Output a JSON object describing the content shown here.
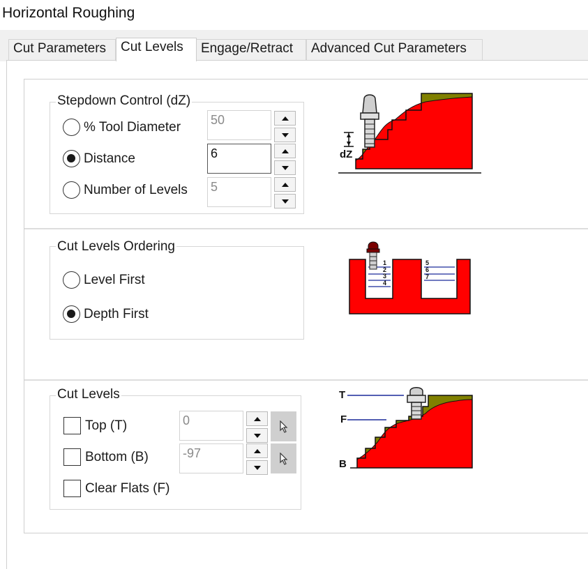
{
  "window": {
    "title": "Horizontal Roughing"
  },
  "tabs": [
    {
      "label": "Cut Parameters",
      "active": false
    },
    {
      "label": "Cut Levels",
      "active": true
    },
    {
      "label": "Engage/Retract",
      "active": false
    },
    {
      "label": "Advanced Cut Parameters",
      "active": false
    }
  ],
  "stepdown": {
    "title": "Stepdown Control (dZ)",
    "options": [
      {
        "label": "% Tool Diameter",
        "selected": false,
        "value": "50"
      },
      {
        "label": "Distance",
        "selected": true,
        "value": "6"
      },
      {
        "label": "Number of Levels",
        "selected": false,
        "value": "5"
      }
    ],
    "illustration": {
      "dz_label": "dZ"
    }
  },
  "ordering": {
    "title": "Cut Levels Ordering",
    "options": [
      {
        "label": "Level First",
        "selected": false
      },
      {
        "label": "Depth First",
        "selected": true
      }
    ],
    "illustration": {
      "level_numbers": [
        "1",
        "2",
        "3",
        "4",
        "5",
        "6",
        "7"
      ]
    }
  },
  "cut_levels": {
    "title": "Cut Levels",
    "top": {
      "label": "Top (T)",
      "checked": false,
      "value": "0"
    },
    "bottom": {
      "label": "Bottom (B)",
      "checked": false,
      "value": "-97"
    },
    "clear_flats": {
      "label": "Clear Flats (F)",
      "checked": false
    },
    "illustration": {
      "t_label": "T",
      "f_label": "F",
      "b_label": "B"
    }
  },
  "colors": {
    "material": "#ff0000",
    "stock": "#808000",
    "level_line": "#1a2a9a",
    "tool_tip": "#7a0000"
  },
  "icons": {
    "spin_up": "triangle-up-icon",
    "spin_down": "triangle-down-icon",
    "picker": "cursor-arrow-icon"
  }
}
